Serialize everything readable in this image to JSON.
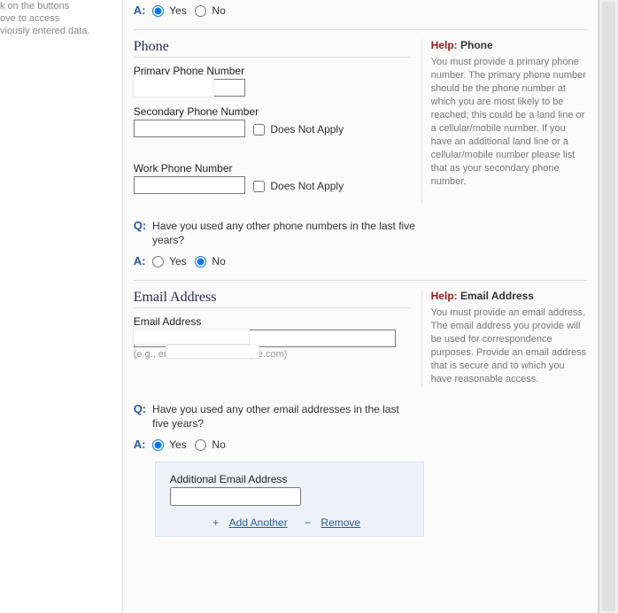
{
  "left_hint_lines": [
    "k on the buttons",
    "ove to access",
    "viously entered data."
  ],
  "qa_prefix": {
    "q": "Q:",
    "a": "A:"
  },
  "yesno": {
    "yes": "Yes",
    "no": "No"
  },
  "does_not_apply": "Does Not Apply",
  "top_answer": {
    "selected": "yes"
  },
  "phone": {
    "heading": "Phone",
    "primary_label": "Primary Phone Number",
    "primary_value": "",
    "secondary_label": "Secondary Phone Number",
    "secondary_value": "",
    "secondary_dna_checked": false,
    "work_label": "Work Phone Number",
    "work_value": "",
    "work_dna_checked": false,
    "question": "Have you used any other phone numbers in the last five years?",
    "answer_selected": "no",
    "help": {
      "title_prefix": "Help:",
      "title_topic": "Phone",
      "body": "You must provide a primary phone number. The primary phone number should be the phone number at which you are most likely to be reached; this could be a land line or a cellular/mobile number. If you have an additional land line or a cellular/mobile number please list that as your secondary phone number."
    }
  },
  "email": {
    "heading": "Email Address",
    "label": "Email Address",
    "value": "",
    "example": "(e.g., emailaddress@example.com)",
    "question": "Have you used any other email addresses in the last five years?",
    "answer_selected": "yes",
    "additional_label": "Additional Email Address",
    "additional_value": "",
    "add_another": "Add Another",
    "remove": "Remove",
    "help": {
      "title_prefix": "Help:",
      "title_topic": "Email Address",
      "body": "You must provide an email address.  The email address you provide will be used for correspondence purposes.  Provide an email address that is secure and to which you have reasonable access."
    }
  }
}
